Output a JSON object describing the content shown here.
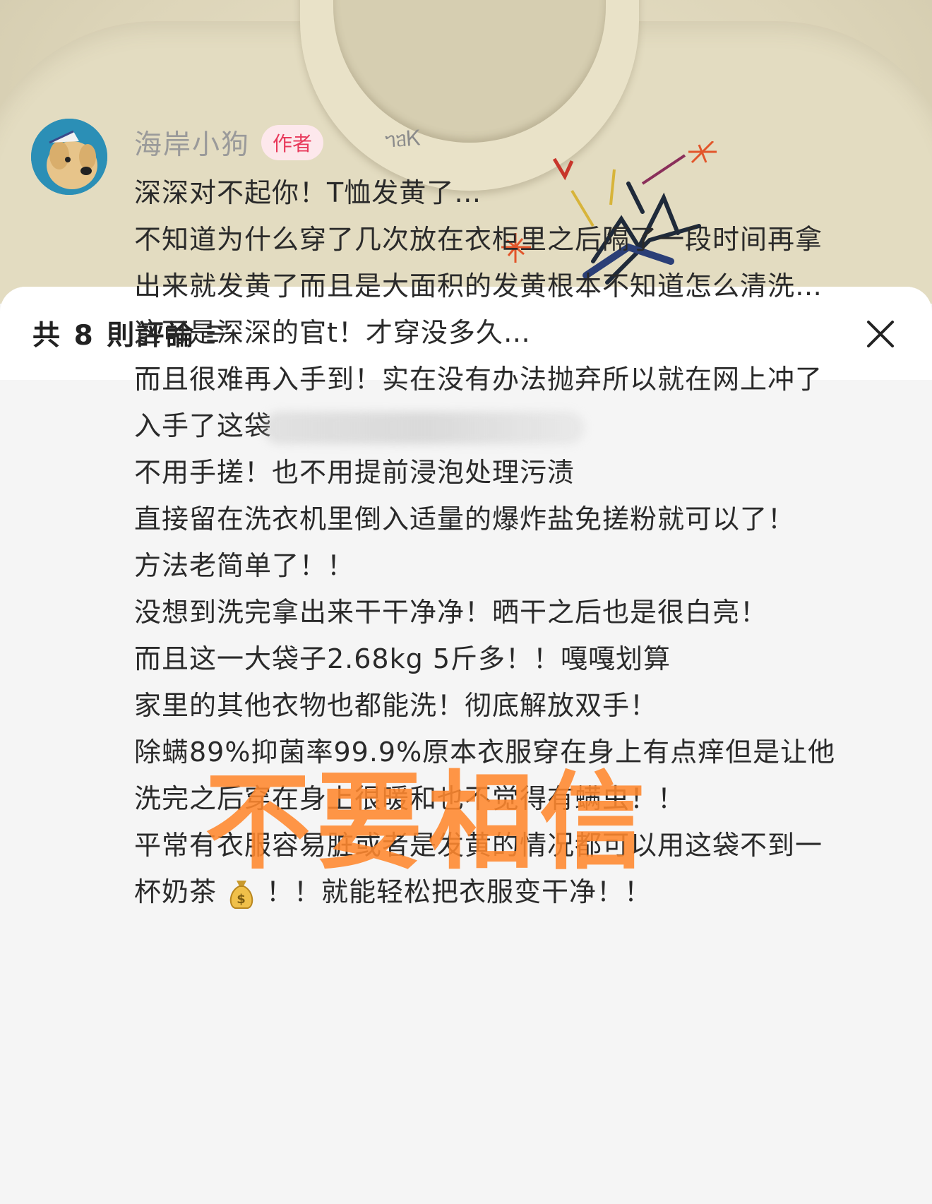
{
  "photo": {
    "shirt_label": "ᥐᥑᏦ",
    "colors": {
      "shirt": "#e3dcc1",
      "stamp": "#ff872d"
    }
  },
  "header": {
    "title": "共 8 則評論",
    "sort_icon": "sort-lines-icon",
    "close_icon": "close-icon"
  },
  "comment": {
    "author": "海岸小狗",
    "badge": "作者",
    "avatar_icon": "dog-avatar",
    "lines": {
      "l1": "深深对不起你！T恤发黄了…",
      "l2": "不知道为什么穿了几次放在衣柜里之后隔了一段时间再拿",
      "l3": "出来就发黄了而且是大面积的发黄根本不知道怎么清洗…",
      "l4": "这可是深深的官t！才穿没多久…",
      "l5": "而且很难再入手到！实在没有办法抛弃所以就在网上冲了",
      "l6": "入手了这袋",
      "l7": "不用手搓！也不用提前浸泡处理污渍",
      "l8": "直接留在洗衣机里倒入适量的爆炸盐免搓粉就可以了！",
      "l9": "方法老简单了！！",
      "l10": "没想到洗完拿出来干干净净！晒干之后也是很白亮！",
      "l11": "而且这一大袋子2.68kg  5斤多！！嘎嘎划算",
      "l12": "家里的其他衣物也都能洗！彻底解放双手！",
      "l13": "除螨89%抑菌率99.9%原本衣服穿在身上有点痒但是让他",
      "l14": "洗完之后穿在身上很暖和也不觉得有螨虫！！",
      "l15": "平常有衣服容易脏或者是发黄的情况都可以用这袋不到一",
      "l16a": "杯奶茶",
      "l16b": "！！就能轻松把衣服变干净！！"
    },
    "emoji": "money-bag-icon"
  },
  "stamp": {
    "text": "不要相信"
  }
}
